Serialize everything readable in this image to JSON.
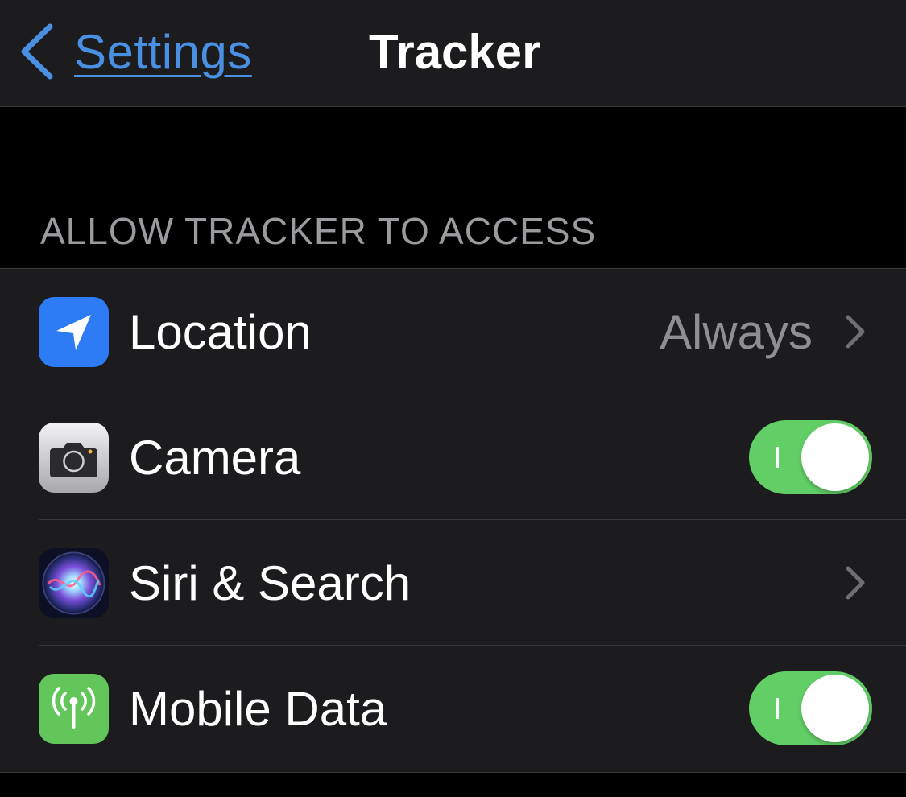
{
  "nav": {
    "back_label": "Settings",
    "title": "Tracker"
  },
  "section": {
    "header": "ALLOW TRACKER TO ACCESS"
  },
  "rows": [
    {
      "label": "Location",
      "value": "Always",
      "icon": "location-arrow-icon",
      "icon_color": "#2d7cf6",
      "accessory": "chevron"
    },
    {
      "label": "Camera",
      "icon": "camera-icon",
      "icon_color": "#d9d9dc",
      "accessory": "toggle",
      "toggle_on": true
    },
    {
      "label": "Siri & Search",
      "icon": "siri-icon",
      "icon_color": "#1b2a6b",
      "accessory": "chevron"
    },
    {
      "label": "Mobile Data",
      "icon": "antenna-icon",
      "icon_color": "#62c65b",
      "accessory": "toggle",
      "toggle_on": true
    }
  ],
  "colors": {
    "accent": "#4a90e2",
    "toggle_on": "#62cf66",
    "background": "#000000",
    "cell": "#1c1c1e"
  }
}
